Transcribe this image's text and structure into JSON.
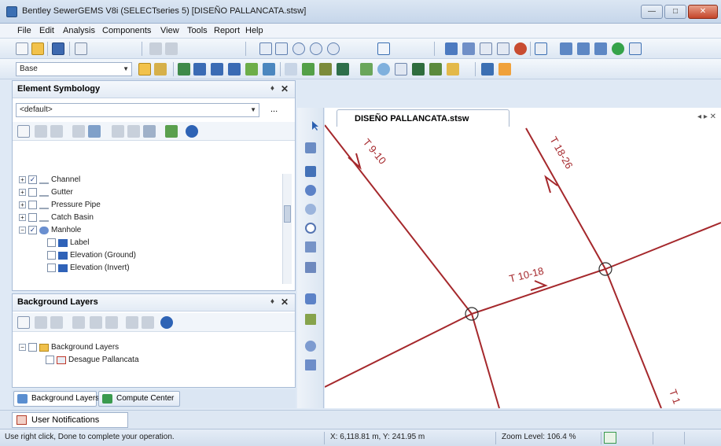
{
  "window": {
    "title": "Bentley SewerGEMS V8i (SELECTseries 5) [DISEÑO PALLANCATA.stsw]",
    "minimize": "—",
    "maximize": "□",
    "close": "✕"
  },
  "menu": [
    "File",
    "Edit",
    "Analysis",
    "Components",
    "View",
    "Tools",
    "Report",
    "Help"
  ],
  "toolbar": {
    "scenario": "Base"
  },
  "element_symbology": {
    "title": "Element Symbology",
    "pin": "♦",
    "close": "✕",
    "profile": "<default>",
    "more": "...",
    "tree": [
      {
        "label": "Channel",
        "checked": true,
        "expand": "+",
        "indent": 0
      },
      {
        "label": "Gutter",
        "checked": false,
        "expand": "+",
        "indent": 0
      },
      {
        "label": "Pressure Pipe",
        "checked": false,
        "expand": "+",
        "indent": 0
      },
      {
        "label": "Catch Basin",
        "checked": false,
        "expand": "+",
        "indent": 0
      },
      {
        "label": "Manhole",
        "checked": true,
        "expand": "−",
        "indent": 0
      },
      {
        "label": "Label",
        "checked": false,
        "expand": "",
        "indent": 1
      },
      {
        "label": "Elevation (Ground)",
        "checked": false,
        "expand": "",
        "indent": 1
      },
      {
        "label": "Elevation (Invert)",
        "checked": false,
        "expand": "",
        "indent": 1
      }
    ]
  },
  "background_layers": {
    "title": "Background Layers",
    "pin": "♦",
    "close": "✕",
    "tree": [
      {
        "label": "Background Layers",
        "expand": "−",
        "indent": 0
      },
      {
        "label": "Desague Pallancata",
        "expand": "",
        "indent": 1
      }
    ]
  },
  "bottom_tabs": [
    "Background Layers",
    "Compute Center"
  ],
  "document_tab": "DISEÑO PALLANCATA.stsw",
  "tab_nav": "◂ ▸ ✕",
  "drawing": {
    "pipe_color": "#a5282c",
    "labels": [
      "T 9-10",
      "T 18-26",
      "T 10-18",
      "T 1"
    ]
  },
  "notifications": {
    "label": "User Notifications"
  },
  "status": {
    "message": "Use right click, Done to complete your operation.",
    "coordinates": "X: 6,118.81 m, Y: 241.95 m",
    "zoom": "Zoom Level: 106.4 %"
  },
  "colors": {
    "accent": "#3b6fb3",
    "toolbar_bg": "#dde7f3",
    "pipe": "#a5282c"
  }
}
